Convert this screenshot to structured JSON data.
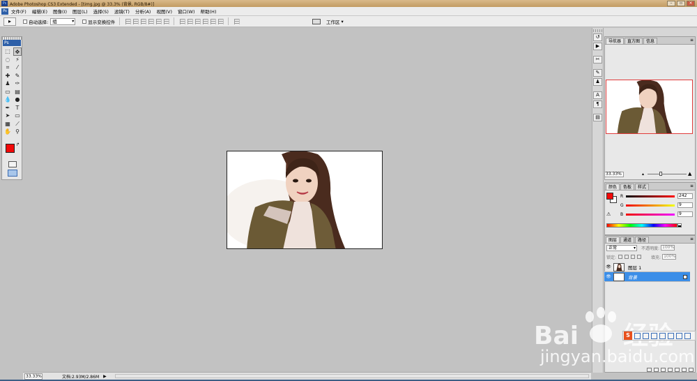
{
  "window": {
    "title": "Adobe Photoshop CS3 Extended - [timg.jpg @ 33.3% (背景, RGB/8#)]"
  },
  "menu": {
    "items": [
      "文件(F)",
      "编辑(E)",
      "图像(I)",
      "图层(L)",
      "选择(S)",
      "滤镜(T)",
      "分析(A)",
      "视图(V)",
      "窗口(W)",
      "帮助(H)"
    ]
  },
  "options_bar": {
    "auto_select_label": "自动选择:",
    "auto_select_value": "组",
    "show_transform_label": "显示变换控件",
    "workspace_label": "工作区"
  },
  "toolbox": {
    "logo": "Ps",
    "foreground_color": "#f20909",
    "background_color": "#ffffff"
  },
  "status": {
    "zoom": "33.33%",
    "doc_info": "文档:2.93M/2.86M"
  },
  "navigator": {
    "tabs": [
      "导航器",
      "直方图",
      "信息"
    ],
    "zoom": "33.33%"
  },
  "color_panel": {
    "tabs": [
      "颜色",
      "色板",
      "样式"
    ],
    "r_label": "R",
    "r_value": "242",
    "g_label": "G",
    "g_value": "9",
    "b_label": "B",
    "b_value": "9"
  },
  "layers_panel": {
    "tabs": [
      "图层",
      "通道",
      "路径"
    ],
    "blend_mode": "正常",
    "opacity_label": "不透明度:",
    "opacity_value": "100%",
    "lock_label": "锁定:",
    "fill_label": "填充:",
    "fill_value": "100%",
    "layers": [
      {
        "name": "图层 1",
        "selected": false
      },
      {
        "name": "背景",
        "selected": true
      }
    ]
  },
  "watermark": {
    "brand": "Bai",
    "brand_suffix": "经验",
    "url": "jingyan.baidu.com"
  },
  "ime": {
    "logo": "S"
  }
}
